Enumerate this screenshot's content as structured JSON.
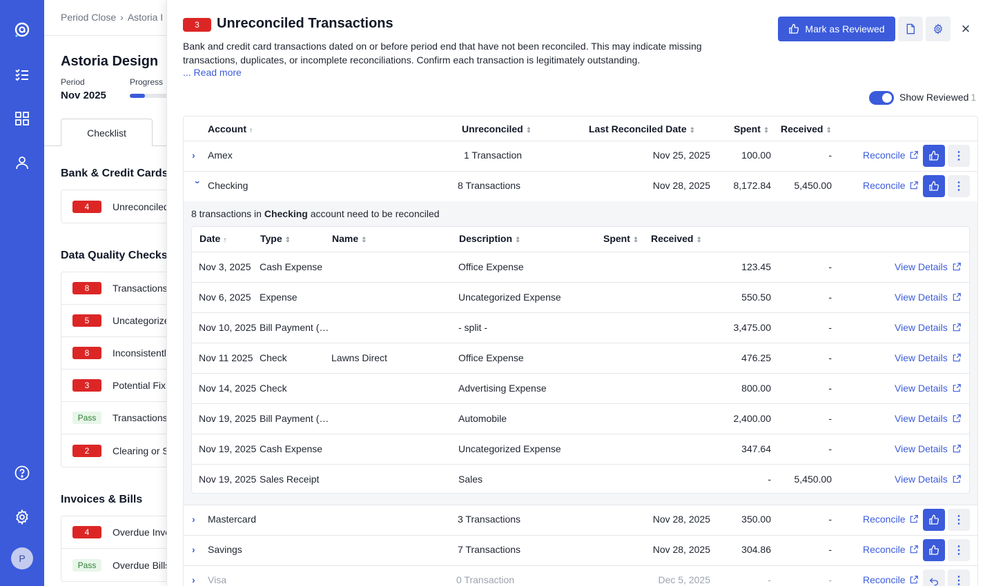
{
  "nav": {
    "items": [
      "logo-icon",
      "checklist-icon",
      "grid-icon",
      "user-icon"
    ],
    "bottom": [
      "help-icon",
      "gear-icon"
    ],
    "avatar_initial": "P"
  },
  "background": {
    "breadcrumb": [
      "Period Close",
      "Astoria I"
    ],
    "company": "Astoria Design",
    "period_label": "Period",
    "period_value": "Nov 2025",
    "progress_label": "Progress",
    "progress": 0.37,
    "tab": "Checklist",
    "sections": [
      {
        "title": "Bank & Credit Cards",
        "items": [
          {
            "badge": "4",
            "kind": "red",
            "text": "Unreconciled"
          }
        ]
      },
      {
        "title": "Data Quality Checks",
        "items": [
          {
            "badge": "8",
            "kind": "red",
            "text": "Transactions"
          },
          {
            "badge": "5",
            "kind": "red",
            "text": "Uncategorize"
          },
          {
            "badge": "8",
            "kind": "red",
            "text": "Inconsistentl"
          },
          {
            "badge": "3",
            "kind": "red",
            "text": "Potential Fix"
          },
          {
            "badge": "Pass",
            "kind": "pass",
            "text": "Transactions"
          },
          {
            "badge": "2",
            "kind": "red",
            "text": "Clearing or S"
          }
        ]
      },
      {
        "title": "Invoices & Bills",
        "items": [
          {
            "badge": "4",
            "kind": "red",
            "text": "Overdue Invo"
          },
          {
            "badge": "Pass",
            "kind": "pass",
            "text": "Overdue Bills"
          }
        ]
      }
    ]
  },
  "panel": {
    "badge": "3",
    "title": "Unreconciled Transactions",
    "description": "Bank and credit card transactions dated on or before period end that have not been reconciled. This may indicate missing transactions, duplicates, or incomplete reconciliations. Confirm each transaction is legitimately outstanding.",
    "read_more": "... Read more",
    "mark_reviewed": "Mark as Reviewed",
    "show_reviewed_label": "Show Reviewed",
    "show_reviewed_count": "1",
    "columns": {
      "account": "Account",
      "unreconciled": "Unreconciled",
      "last_reconciled": "Last Reconciled Date",
      "spent": "Spent",
      "received": "Received"
    },
    "reconcile_label": "Reconcile",
    "accounts": [
      {
        "name": "Amex",
        "unreconciled": "1 Transaction",
        "last": "Nov 25,  2025",
        "spent": "100.00",
        "received": "-",
        "expanded": false
      },
      {
        "name": "Checking",
        "unreconciled": "8 Transactions",
        "last": "Nov 28,  2025",
        "spent": "8,172.84",
        "received": "5,450.00",
        "expanded": true
      },
      {
        "name": "Mastercard",
        "unreconciled": "3 Transactions",
        "last": "Nov 28,  2025",
        "spent": "350.00",
        "received": "-",
        "expanded": false
      },
      {
        "name": "Savings",
        "unreconciled": "7 Transactions",
        "last": "Nov 28,  2025",
        "spent": "304.86",
        "received": "-",
        "expanded": false
      },
      {
        "name": "Visa",
        "unreconciled": "0 Transaction",
        "last": "Dec 5,  2025",
        "spent": "-",
        "received": "-",
        "expanded": false,
        "muted": true
      }
    ],
    "sub": {
      "note_prefix": "8 transactions in ",
      "note_account": "Checking",
      "note_suffix": " account need to be reconciled",
      "columns": {
        "date": "Date",
        "type": "Type",
        "name": "Name",
        "description": "Description",
        "spent": "Spent",
        "received": "Received"
      },
      "view_details": "View Details",
      "rows": [
        {
          "date": "Nov 3, 2025",
          "type": "Cash Expense",
          "name": "",
          "description": "Office Expense",
          "spent": "123.45",
          "received": "-"
        },
        {
          "date": "Nov 6, 2025",
          "type": "Expense",
          "name": "",
          "description": "Uncategorized Expense",
          "spent": "550.50",
          "received": "-"
        },
        {
          "date": "Nov 10, 2025",
          "type": "Bill Payment (…",
          "name": "",
          "description": "- split -",
          "spent": "3,475.00",
          "received": "-"
        },
        {
          "date": "Nov 11 2025",
          "type": "Check",
          "name": "Lawns Direct",
          "description": "Office Expense",
          "spent": "476.25",
          "received": "-"
        },
        {
          "date": "Nov 14, 2025",
          "type": "Check",
          "name": "",
          "description": "Advertising Expense",
          "spent": "800.00",
          "received": "-"
        },
        {
          "date": "Nov 19, 2025",
          "type": "Bill Payment (…",
          "name": "",
          "description": "Automobile",
          "spent": "2,400.00",
          "received": "-"
        },
        {
          "date": "Nov 19, 2025",
          "type": "Cash Expense",
          "name": "",
          "description": "Uncategorized Expense",
          "spent": "347.64",
          "received": "-"
        },
        {
          "date": "Nov 19, 2025",
          "type": "Sales Receipt",
          "name": "",
          "description": "Sales",
          "spent": "-",
          "received": "5,450.00"
        }
      ]
    }
  }
}
